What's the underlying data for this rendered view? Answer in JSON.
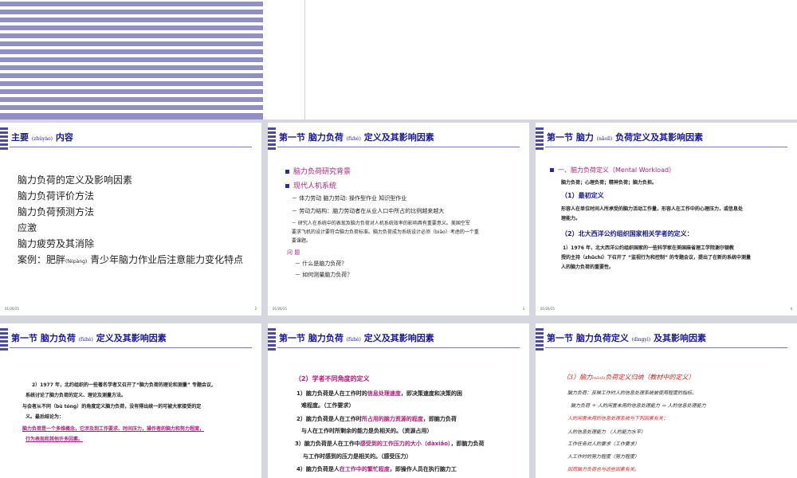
{
  "slides": [
    {
      "title": "主要",
      "title_pinyin": "(zhǔyào)",
      "title_tail": "内容",
      "items": [
        "脑力负荷的定义及影响因素",
        "脑力负荷评价方法",
        "脑力负荷预测方法",
        "应激",
        "脑力疲劳及其消除",
        "案例：肥胖",
        "(féipàng)",
        "青少年脑力作业后注意能力变化特点"
      ],
      "date": "01/26/25",
      "page": "2"
    },
    {
      "title": "第一节  脑力负荷",
      "title_pinyin": "(fùhè)",
      "title_tail": "定义及其影响因素",
      "b1": "脑力负荷研究背景",
      "b2": "现代人机系统",
      "l1": "－   体力劳动     脑力劳动:      操作型作业         知识型作业",
      "l2": "－   劳动力结构：脑力劳动者在从业人口中所占的比例越来越大",
      "l3a": "－   研究人在系统中的表现及脑力负荷对人机系统效率的影响具有重要意义。美国空军",
      "l3b": "要求飞机的设计要符合脑力负荷标准。脑力负荷成为系统设计必须（biǎo）考虑的一个重",
      "l3c": "要课题。",
      "q": "问  题",
      "q1": "－     什么是脑力负荷？",
      "q2": "－      如何测量脑力负荷？",
      "date": "01/26/25",
      "page": "3"
    },
    {
      "title": "第一节  脑力",
      "title_pinyin": "(nǎolì)",
      "title_tail": "负荷定义及其影响因素",
      "h1": "一、脑力负荷定义（Mental Workload）",
      "h1s": "脑力负荷；心理负荷；精神负荷；脑力负担。",
      "h2": "（1）最初定义",
      "h2a": "形容人在单位时间人所承受的脑力活动工作量，形容人在工作中的心理压力，或信息处",
      "h2b": "理能力。",
      "h3": "（2）北大西洋公约组织国家相关学者的定义：",
      "h3a": "1）1976 年，北大西洋公约组织国家的一些科学家在美国麻省理工学院谢尔顿教",
      "h3b": "授的主持（zhǔchí）下召开了 “监视行为和控制” 的专题会议，提出了在新的系统中测量",
      "h3c": "人的脑力负荷的重要性。",
      "date": "01/26/25",
      "page": "4"
    },
    {
      "title": "第一节  脑力负荷",
      "title_pinyin": "(fùhè)",
      "title_tail": "定义及其影响因素",
      "p1": "2）1977 年，北约组织的一些著名学者又召开了“脑力负荷的理论和测量” 专题会议,",
      "p2": "系统讨论了脑力负荷的定义、理论及测量方法。",
      "p3": "与会者从不同（bù tóng）的角度定义脑力负荷，没有得出统一的可被大家接受的定",
      "p4": "义。最后结论为：",
      "p5": "脑力负荷是一个多维概念，它涉及到工作要求、时间压力，操作者的脑力和努力程度，",
      "p6": "行为表现和其他许多因素。"
    },
    {
      "title": "第一节  脑力负荷",
      "title_pinyin": "(fùhè)",
      "title_tail": "定义及其影响因素",
      "s0": "（2）学者不同角度的定义",
      "s1a": "1）脑力负荷是人在工作时的",
      "s1b": "信息处理速度",
      "s1c": "，即决策速度和决策的困",
      "s1d": "难程度。（工作要求）",
      "s2a": "2）脑力负荷是人在工作时",
      "s2b": "所占用的脑力资源的程度",
      "s2c": "，即脑力负荷",
      "s2d": "与人在工作时所剩余的能力是负相关的。（资源占用）",
      "s3a": "3）脑力负荷是人在工作中",
      "s3b": "感受到的工作压力的大小（dàxiǎo）",
      "s3c": "，即脑力负荷",
      "s3d": "与工作时感到的压力是相关的。（感受压力）",
      "s4a": "4）脑力负荷是人",
      "s4b": "在工作中的繁忙程度",
      "s4c": "，即操作人员在执行脑力工"
    },
    {
      "title": "第一节  脑力负荷定义",
      "title_pinyin": "(dìngyì)",
      "title_tail": "及其影响因素",
      "t0": "（3）脑力",
      "t0p": "(nǎolì)",
      "t0b": "负荷定义归纳（教材中的定义）",
      "t1": "脑力负荷：反映工作时人的信息处理系统被使用程度的指标。",
      "t2": "脑力负荷 ＋ 人的闲置未用的信息处理能力 ＝ 人的信息处理能力",
      "t3": "人的闲置未用的信息处理系统与下列因素有关：",
      "t4": "人的信息处理能力    （人的能力水平）",
      "t5": "工作任务对人的要求（工作要求）",
      "t6": "人工作时的努力程度（努力程度）",
      "t7": "因而脑力负荷也与这些因素有关。"
    }
  ]
}
